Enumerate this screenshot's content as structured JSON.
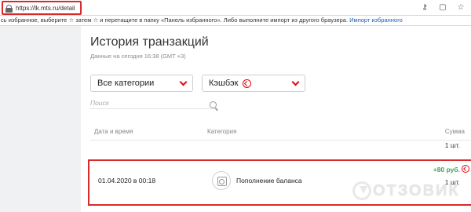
{
  "browser": {
    "url": "https://lk.mts.ru/detail",
    "icons": [
      "key-icon",
      "reader-icon",
      "star-icon"
    ],
    "bookmarks_text": "сь избранное, выберите ☆ затем ☆ и перетащите в папку «Панель избранного». Либо выполните импорт из другого браузера.",
    "bookmarks_link": "Импорт избранного"
  },
  "page": {
    "title": "История транзакций",
    "subtitle": "Данные на сегодня 16:38 (GMT +3)",
    "accent_color": "#e30611",
    "filters": {
      "category": "Все категории",
      "cashback": "Кэшбэк"
    },
    "search": {
      "placeholder": "Поиск"
    },
    "table": {
      "headers": {
        "date": "Дата и время",
        "category": "Категория",
        "sum": "Сумма"
      },
      "top_qty": "1 шт.",
      "rows": [
        {
          "date": "01.04.2020 в 00:18",
          "category": "Пополнение баланса",
          "amount": "+80 руб.",
          "qty": "1 шт."
        }
      ]
    }
  },
  "watermark": {
    "text": "ОТЗОВИК"
  }
}
